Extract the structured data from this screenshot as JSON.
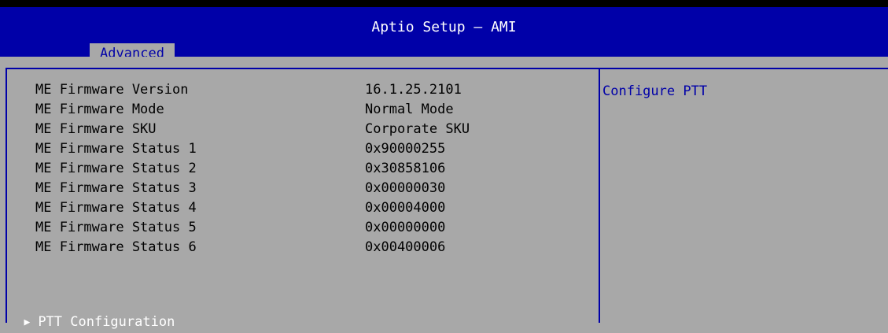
{
  "header": {
    "app_title": "Aptio Setup – AMI",
    "active_tab": "Advanced"
  },
  "colors": {
    "header_bg": "#0000a8",
    "body_bg": "#a8a8a8",
    "text": "#000000",
    "highlight_text": "#ffffff",
    "help_text": "#0000a8"
  },
  "info_rows": [
    {
      "label": "ME Firmware Version",
      "value": "16.1.25.2101"
    },
    {
      "label": "ME Firmware Mode",
      "value": "Normal Mode"
    },
    {
      "label": "ME Firmware SKU",
      "value": "Corporate SKU"
    },
    {
      "label": "ME Firmware Status 1",
      "value": "0x90000255"
    },
    {
      "label": "ME Firmware Status 2",
      "value": "0x30858106"
    },
    {
      "label": "ME Firmware Status 3",
      "value": "0x00000030"
    },
    {
      "label": "ME Firmware Status 4",
      "value": "0x00004000"
    },
    {
      "label": "ME Firmware Status 5",
      "value": "0x00000000"
    },
    {
      "label": "ME Firmware Status 6",
      "value": "0x00400006"
    }
  ],
  "submenu": {
    "arrow_icon": "▶",
    "label": "PTT Configuration"
  },
  "help": {
    "text": "Configure PTT"
  }
}
